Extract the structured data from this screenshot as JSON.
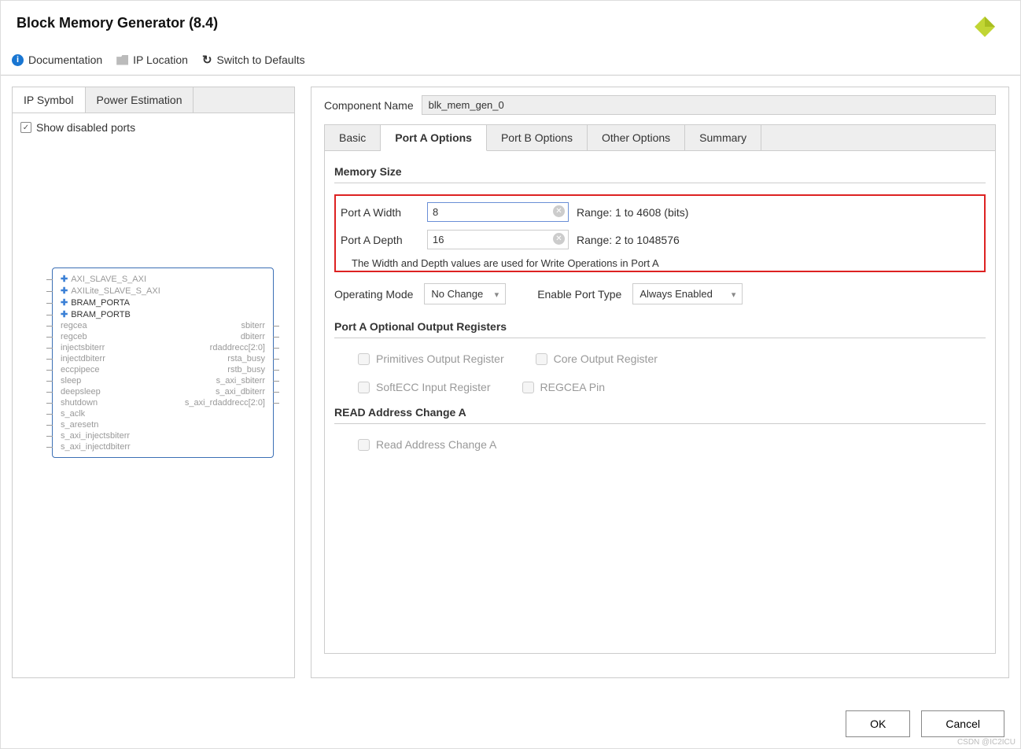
{
  "header": {
    "title": "Block Memory Generator (8.4)"
  },
  "toolbar": {
    "documentation": "Documentation",
    "ip_location": "IP Location",
    "switch_defaults": "Switch to Defaults"
  },
  "left_tabs": {
    "ip_symbol": "IP Symbol",
    "power_estimation": "Power Estimation"
  },
  "show_disabled": {
    "label": "Show disabled ports",
    "checked": true
  },
  "ip_ports": {
    "left": [
      {
        "label": "AXI_SLAVE_S_AXI",
        "plus": true,
        "dim": true
      },
      {
        "label": "AXILite_SLAVE_S_AXI",
        "plus": true,
        "dim": true
      },
      {
        "label": "BRAM_PORTA",
        "plus": true,
        "dim": false
      },
      {
        "label": "BRAM_PORTB",
        "plus": true,
        "dim": false
      },
      {
        "label": "regcea",
        "plus": false,
        "dim": true
      },
      {
        "label": "regceb",
        "plus": false,
        "dim": true
      },
      {
        "label": "injectsbiterr",
        "plus": false,
        "dim": true
      },
      {
        "label": "injectdbiterr",
        "plus": false,
        "dim": true
      },
      {
        "label": "eccpipece",
        "plus": false,
        "dim": true
      },
      {
        "label": "sleep",
        "plus": false,
        "dim": true
      },
      {
        "label": "deepsleep",
        "plus": false,
        "dim": true
      },
      {
        "label": "shutdown",
        "plus": false,
        "dim": true
      },
      {
        "label": "s_aclk",
        "plus": false,
        "dim": true
      },
      {
        "label": "s_aresetn",
        "plus": false,
        "dim": true
      },
      {
        "label": "s_axi_injectsbiterr",
        "plus": false,
        "dim": true
      },
      {
        "label": "s_axi_injectdbiterr",
        "plus": false,
        "dim": true
      }
    ],
    "right": [
      "sbiterr",
      "dbiterr",
      "rdaddrecc[2:0]",
      "rsta_busy",
      "rstb_busy",
      "s_axi_sbiterr",
      "s_axi_dbiterr",
      "s_axi_rdaddrecc[2:0]"
    ]
  },
  "component": {
    "label": "Component Name",
    "value": "blk_mem_gen_0"
  },
  "main_tabs": [
    "Basic",
    "Port A Options",
    "Port B Options",
    "Other Options",
    "Summary"
  ],
  "active_tab_index": 1,
  "memory_size": {
    "title": "Memory Size",
    "width_label": "Port A Width",
    "width_value": "8",
    "width_range": "Range: 1 to 4608 (bits)",
    "depth_label": "Port A Depth",
    "depth_value": "16",
    "depth_range": "Range: 2 to 1048576",
    "note": "The Width and Depth values are used for Write Operations in Port A"
  },
  "operating_mode": {
    "label": "Operating Mode",
    "value": "No Change"
  },
  "enable_port": {
    "label": "Enable Port Type",
    "value": "Always Enabled"
  },
  "optional_regs": {
    "title": "Port A Optional Output Registers",
    "items": [
      "Primitives Output Register",
      "Core Output Register",
      "SoftECC Input Register",
      "REGCEA Pin"
    ]
  },
  "read_addr": {
    "title": "READ Address Change A",
    "item": "Read Address Change A"
  },
  "footer": {
    "ok": "OK",
    "cancel": "Cancel"
  },
  "watermark": "CSDN @IC2ICU"
}
